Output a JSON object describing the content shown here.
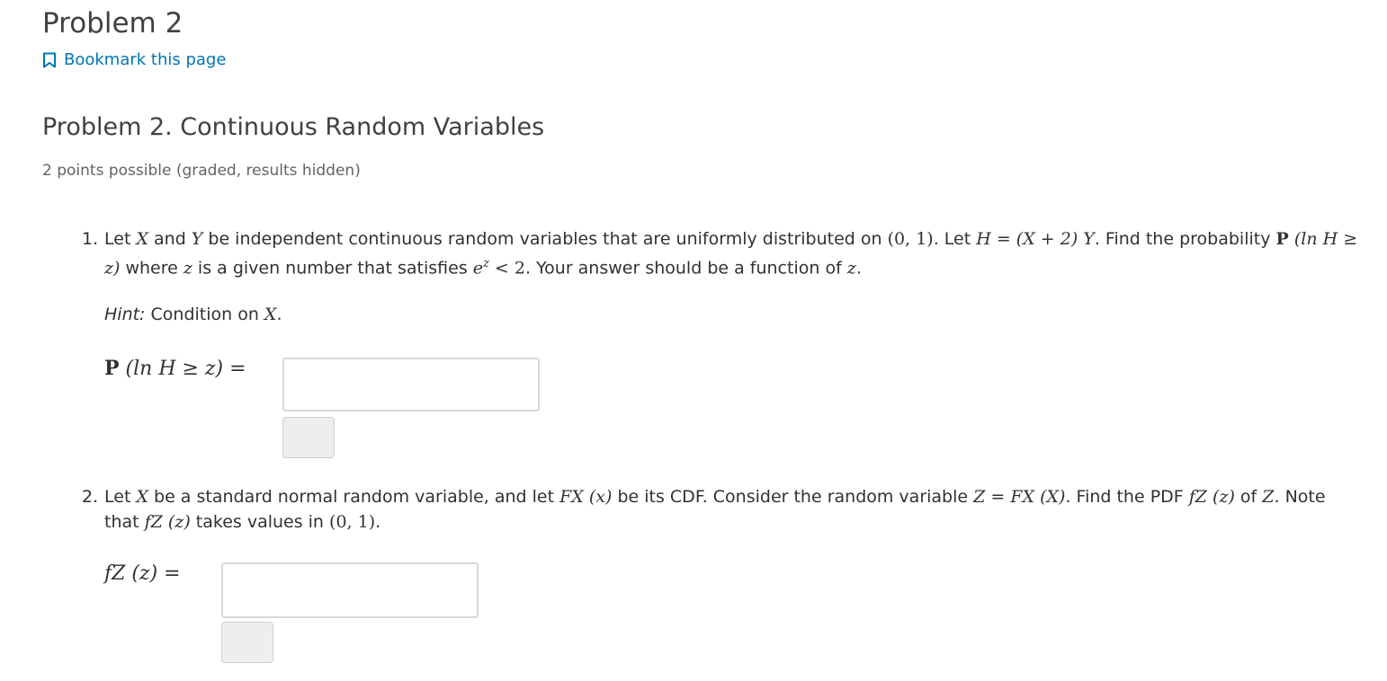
{
  "page": {
    "title": "Problem 2",
    "bookmark_label": "Bookmark this page",
    "problem_heading": "Problem 2. Continuous Random Variables",
    "points_text": "2 points possible (graded, results hidden)"
  },
  "questions": [
    {
      "number": "1.",
      "t1": "Let ",
      "x": "X",
      "t2": " and ",
      "y": "Y",
      "t3": " be independent continuous random variables that are uniformly distributed on ",
      "interval": "(0, 1)",
      "t4": ". Let ",
      "h_def": "H = (X + 2) Y",
      "t5": ". Find the probability ",
      "prob_bold": "P",
      "prob_expr": " (ln H ≥ z)",
      "t6": " where ",
      "z": "z",
      "t7": " is a given number that satisfies ",
      "ez_base": "e",
      "ez_sup": "z",
      "ez_rest": " < 2",
      "t8": ". Your answer should be a function of ",
      "z2": "z",
      "t9": ".",
      "hint_label": "Hint:",
      "hint_text": " Condition on ",
      "hint_var": "X",
      "hint_end": ".",
      "answer_label_bold": "P",
      "answer_label_rest": " (ln H ≥ z) =",
      "answer_value": ""
    },
    {
      "number": "2.",
      "t1": "Let ",
      "x": "X",
      "t2": " be a standard normal random variable, and let ",
      "cdf": "FX (x)",
      "t3": " be its CDF. Consider the random variable ",
      "z_def": "Z = FX (X)",
      "t4": ". Find the PDF ",
      "pdf": "fZ (z)",
      "t5": " of ",
      "zvar": "Z",
      "t6": ". Note that ",
      "pdf2": "fZ (z)",
      "t7": " takes values in ",
      "interval": "(0, 1)",
      "t8": ".",
      "answer_label": "fZ (z) =",
      "answer_value": ""
    }
  ]
}
